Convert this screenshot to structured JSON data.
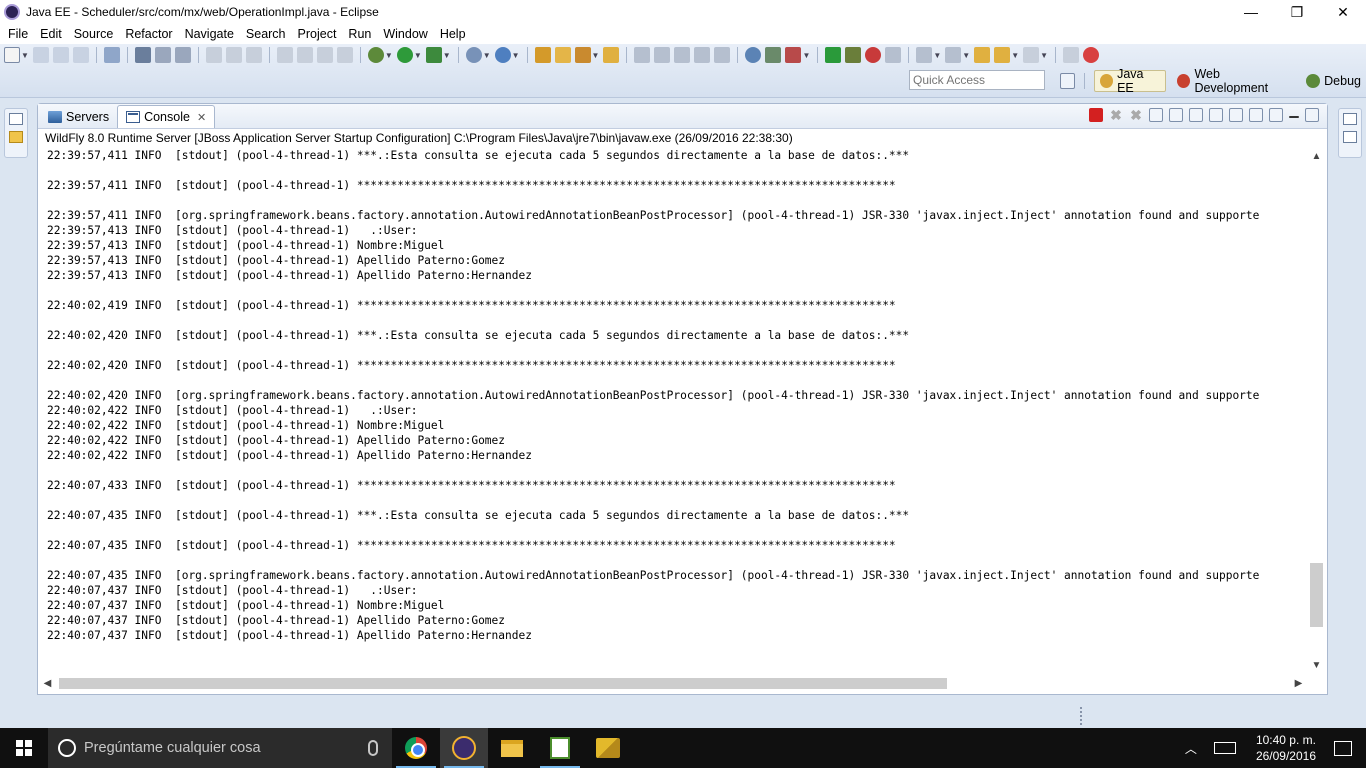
{
  "window": {
    "title": "Java EE - Scheduler/src/com/mx/web/OperationImpl.java - Eclipse",
    "controls": [
      "—",
      "❐",
      "✕"
    ]
  },
  "menu": [
    "File",
    "Edit",
    "Source",
    "Refactor",
    "Navigate",
    "Search",
    "Project",
    "Run",
    "Window",
    "Help"
  ],
  "toolbar": {
    "quick_access_placeholder": "Quick Access",
    "perspectives": [
      {
        "label": "Java EE",
        "active": true
      },
      {
        "label": "Web Development",
        "active": false
      },
      {
        "label": "Debug",
        "active": false
      }
    ]
  },
  "view": {
    "tabs": [
      {
        "label": "Servers",
        "active": false
      },
      {
        "label": "Console",
        "active": true
      }
    ],
    "close_glyph": "✕",
    "description": "WildFly 8.0 Runtime Server [JBoss Application Server Startup Configuration] C:\\Program Files\\Java\\jre7\\bin\\javaw.exe (26/09/2016 22:38:30)"
  },
  "console_lines": [
    "22:39:57,411 INFO  [stdout] (pool-4-thread-1) ***.:Esta consulta se ejecuta cada 5 segundos directamente a la base de datos:.***",
    "",
    "22:39:57,411 INFO  [stdout] (pool-4-thread-1) ********************************************************************************",
    "",
    "22:39:57,411 INFO  [org.springframework.beans.factory.annotation.AutowiredAnnotationBeanPostProcessor] (pool-4-thread-1) JSR-330 'javax.inject.Inject' annotation found and supporte",
    "22:39:57,413 INFO  [stdout] (pool-4-thread-1)   .:User:",
    "22:39:57,413 INFO  [stdout] (pool-4-thread-1) Nombre:Miguel",
    "22:39:57,413 INFO  [stdout] (pool-4-thread-1) Apellido Paterno:Gomez",
    "22:39:57,413 INFO  [stdout] (pool-4-thread-1) Apellido Paterno:Hernandez",
    "",
    "22:40:02,419 INFO  [stdout] (pool-4-thread-1) ********************************************************************************",
    "",
    "22:40:02,420 INFO  [stdout] (pool-4-thread-1) ***.:Esta consulta se ejecuta cada 5 segundos directamente a la base de datos:.***",
    "",
    "22:40:02,420 INFO  [stdout] (pool-4-thread-1) ********************************************************************************",
    "",
    "22:40:02,420 INFO  [org.springframework.beans.factory.annotation.AutowiredAnnotationBeanPostProcessor] (pool-4-thread-1) JSR-330 'javax.inject.Inject' annotation found and supporte",
    "22:40:02,422 INFO  [stdout] (pool-4-thread-1)   .:User:",
    "22:40:02,422 INFO  [stdout] (pool-4-thread-1) Nombre:Miguel",
    "22:40:02,422 INFO  [stdout] (pool-4-thread-1) Apellido Paterno:Gomez",
    "22:40:02,422 INFO  [stdout] (pool-4-thread-1) Apellido Paterno:Hernandez",
    "",
    "22:40:07,433 INFO  [stdout] (pool-4-thread-1) ********************************************************************************",
    "",
    "22:40:07,435 INFO  [stdout] (pool-4-thread-1) ***.:Esta consulta se ejecuta cada 5 segundos directamente a la base de datos:.***",
    "",
    "22:40:07,435 INFO  [stdout] (pool-4-thread-1) ********************************************************************************",
    "",
    "22:40:07,435 INFO  [org.springframework.beans.factory.annotation.AutowiredAnnotationBeanPostProcessor] (pool-4-thread-1) JSR-330 'javax.inject.Inject' annotation found and supporte",
    "22:40:07,437 INFO  [stdout] (pool-4-thread-1)   .:User:",
    "22:40:07,437 INFO  [stdout] (pool-4-thread-1) Nombre:Miguel",
    "22:40:07,437 INFO  [stdout] (pool-4-thread-1) Apellido Paterno:Gomez",
    "22:40:07,437 INFO  [stdout] (pool-4-thread-1) Apellido Paterno:Hernandez"
  ],
  "scroll": {
    "vertical_position_fraction": 0.93,
    "horizontal_visible_fraction": 0.72
  },
  "taskbar": {
    "search_placeholder": "Pregúntame cualquier cosa",
    "apps": [
      "chrome",
      "eclipse",
      "file-explorer",
      "chart-app",
      "database-app"
    ],
    "clock_time": "10:40 p. m.",
    "clock_date": "26/09/2016"
  },
  "colors": {
    "toolbar_bg": "#d5e0ef",
    "taskbar_bg": "#101010",
    "stop_button": "#d32020",
    "perspective_active_bg": "#f7f3d9"
  }
}
